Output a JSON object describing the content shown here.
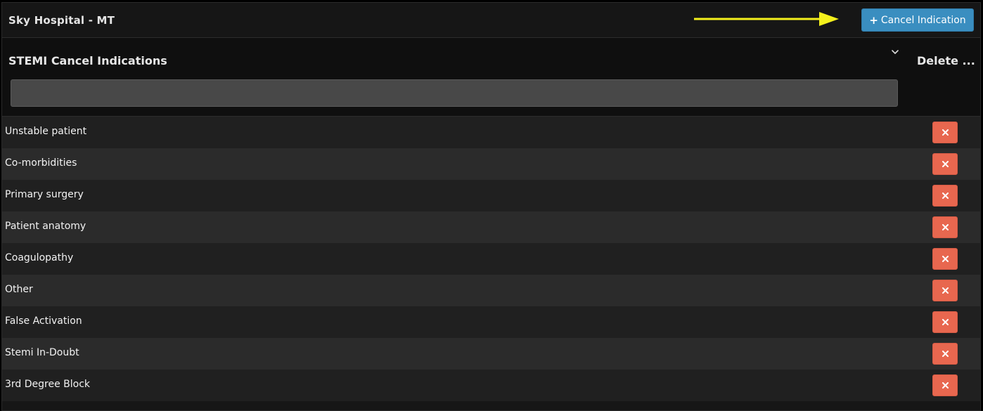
{
  "header": {
    "title": "Sky Hospital - MT",
    "add_button_label": "Cancel Indication",
    "add_button_icon": "plus-icon"
  },
  "table": {
    "column_title": "STEMI Cancel Indications",
    "delete_column_title": "Delete ...",
    "filter_value": "",
    "rows": [
      {
        "label": "Unstable patient"
      },
      {
        "label": "Co-morbidities"
      },
      {
        "label": "Primary surgery"
      },
      {
        "label": "Patient anatomy"
      },
      {
        "label": "Coagulopathy"
      },
      {
        "label": "Other"
      },
      {
        "label": "False Activation"
      },
      {
        "label": "Stemi In-Doubt"
      },
      {
        "label": "3rd Degree Block"
      }
    ]
  },
  "colors": {
    "accent_blue": "#3a8ec0",
    "delete_red": "#e8674f",
    "arrow_yellow": "#f4f01c"
  }
}
